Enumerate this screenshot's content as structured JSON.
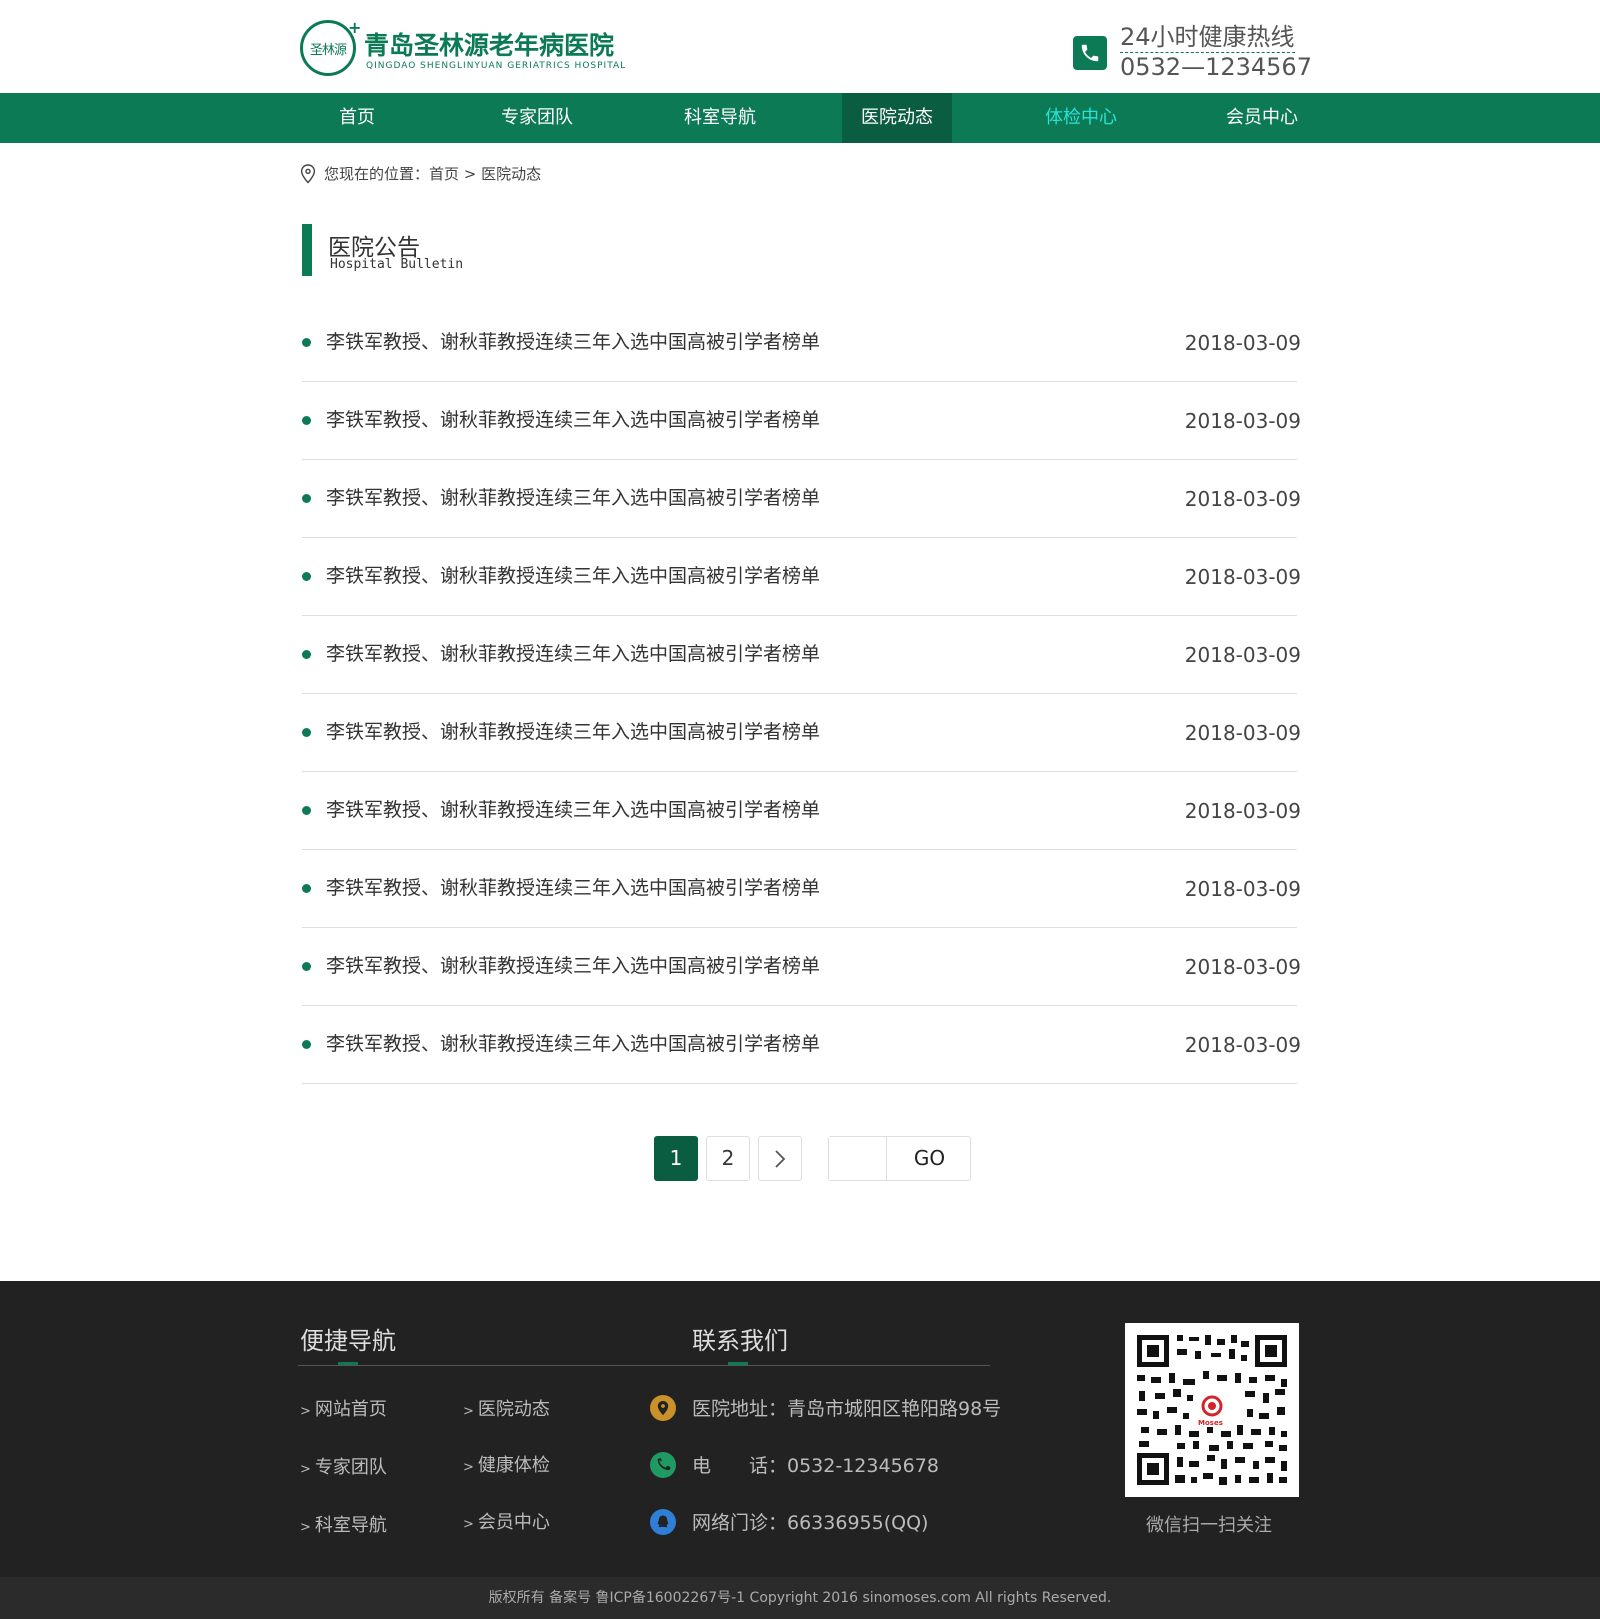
{
  "header": {
    "logo_mark": "圣林源",
    "logo_cn": "青岛圣林源老年病医院",
    "logo_en": "QINGDAO SHENGLINYUAN GERIATRICS HOSPITAL",
    "hotline_label": "24小时健康热线",
    "hotline_number": "0532—1234567",
    "phone_icon": "phone-icon"
  },
  "nav": {
    "items": [
      {
        "label": "首页"
      },
      {
        "label": "专家团队"
      },
      {
        "label": "科室导航"
      },
      {
        "label": "医院动态",
        "active": true
      },
      {
        "label": "体检中心",
        "highlight": true
      },
      {
        "label": "会员中心"
      }
    ]
  },
  "breadcrumb": {
    "text": "您现在的位置：首页 > 医院动态",
    "icon": "location-pin-icon"
  },
  "section": {
    "title_cn": "医院公告",
    "title_en": "Hospital Bulletin"
  },
  "list": [
    {
      "title": "李铁军教授、谢秋菲教授连续三年入选中国高被引学者榜单",
      "date": "2018-03-09"
    },
    {
      "title": "李铁军教授、谢秋菲教授连续三年入选中国高被引学者榜单",
      "date": "2018-03-09"
    },
    {
      "title": "李铁军教授、谢秋菲教授连续三年入选中国高被引学者榜单",
      "date": "2018-03-09"
    },
    {
      "title": "李铁军教授、谢秋菲教授连续三年入选中国高被引学者榜单",
      "date": "2018-03-09"
    },
    {
      "title": "李铁军教授、谢秋菲教授连续三年入选中国高被引学者榜单",
      "date": "2018-03-09"
    },
    {
      "title": "李铁军教授、谢秋菲教授连续三年入选中国高被引学者榜单",
      "date": "2018-03-09"
    },
    {
      "title": "李铁军教授、谢秋菲教授连续三年入选中国高被引学者榜单",
      "date": "2018-03-09"
    },
    {
      "title": "李铁军教授、谢秋菲教授连续三年入选中国高被引学者榜单",
      "date": "2018-03-09"
    },
    {
      "title": "李铁军教授、谢秋菲教授连续三年入选中国高被引学者榜单",
      "date": "2018-03-09"
    },
    {
      "title": "李铁军教授、谢秋菲教授连续三年入选中国高被引学者榜单",
      "date": "2018-03-09"
    }
  ],
  "pagination": {
    "pages": [
      "1",
      "2"
    ],
    "current": "1",
    "next_icon": "chevron-right-icon",
    "go_label": "GO",
    "go_value": ""
  },
  "footer": {
    "nav_title": "便捷导航",
    "contact_title": "联系我们",
    "links": [
      "网站首页",
      "医院动态",
      "专家团队",
      "健康体检",
      "科室导航",
      "会员中心"
    ],
    "link_arrow": ">",
    "address": "医院地址：青岛市城阳区艳阳路98号",
    "phone": "电　　话：0532-12345678",
    "online": "网络门诊：66336955(QQ)",
    "qr_caption": "微信扫一扫关注",
    "qr_logo": "Moses",
    "copyright": "版权所有 备案号 鲁ICP备16002267号-1 Copyright 2016 sinomoses.com All rights Reserved.",
    "colors": {
      "address_icon": "#c8912a",
      "phone_icon": "#1f9a62",
      "qq_icon": "#2f7fd8"
    }
  },
  "colors": {
    "brand": "#0b7a55",
    "brand_dark": "#0a5d40",
    "nav_highlight": "#29e3d6"
  }
}
